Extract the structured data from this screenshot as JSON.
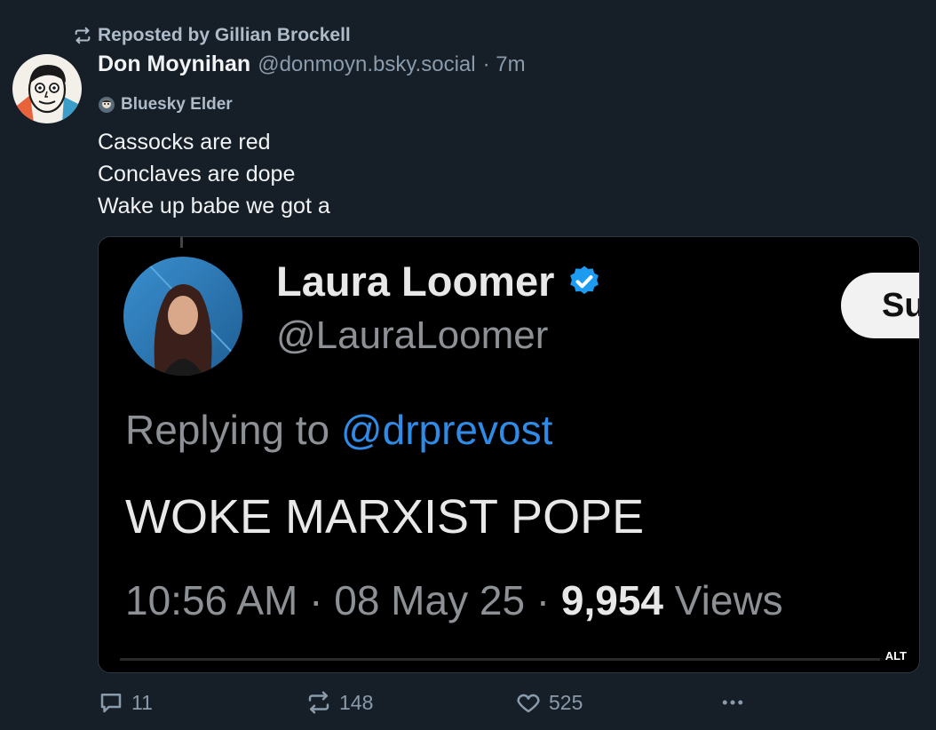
{
  "repost": {
    "text": "Reposted by Gillian Brockell"
  },
  "author": {
    "display_name": "Don Moynihan",
    "handle": "@donmoyn.bsky.social",
    "time": "· 7m",
    "badge": "Bluesky Elder"
  },
  "post": {
    "lines": [
      "Cassocks are red",
      "Conclaves are dope",
      "Wake up babe we got a"
    ]
  },
  "embed": {
    "name": "Laura Loomer",
    "handle": "@LauraLoomer",
    "subscribe_label": "Su",
    "reply_prefix": "Replying to ",
    "reply_mention": "@drprevost",
    "body": "WOKE MARXIST POPE",
    "meta_time": "10:56 AM · 08 May 25 · ",
    "meta_views_count": "9,954",
    "meta_views_label": " Views",
    "alt_label": "ALT",
    "colors": {
      "mention": "#2f8be6",
      "verified": "#1d9bf0"
    }
  },
  "actions": {
    "reply_count": "11",
    "repost_count": "148",
    "like_count": "525",
    "more_icon": "ellipsis-icon"
  },
  "colors": {
    "background": "#161e27",
    "muted": "#8a9bac",
    "text": "#f1f3f5"
  }
}
